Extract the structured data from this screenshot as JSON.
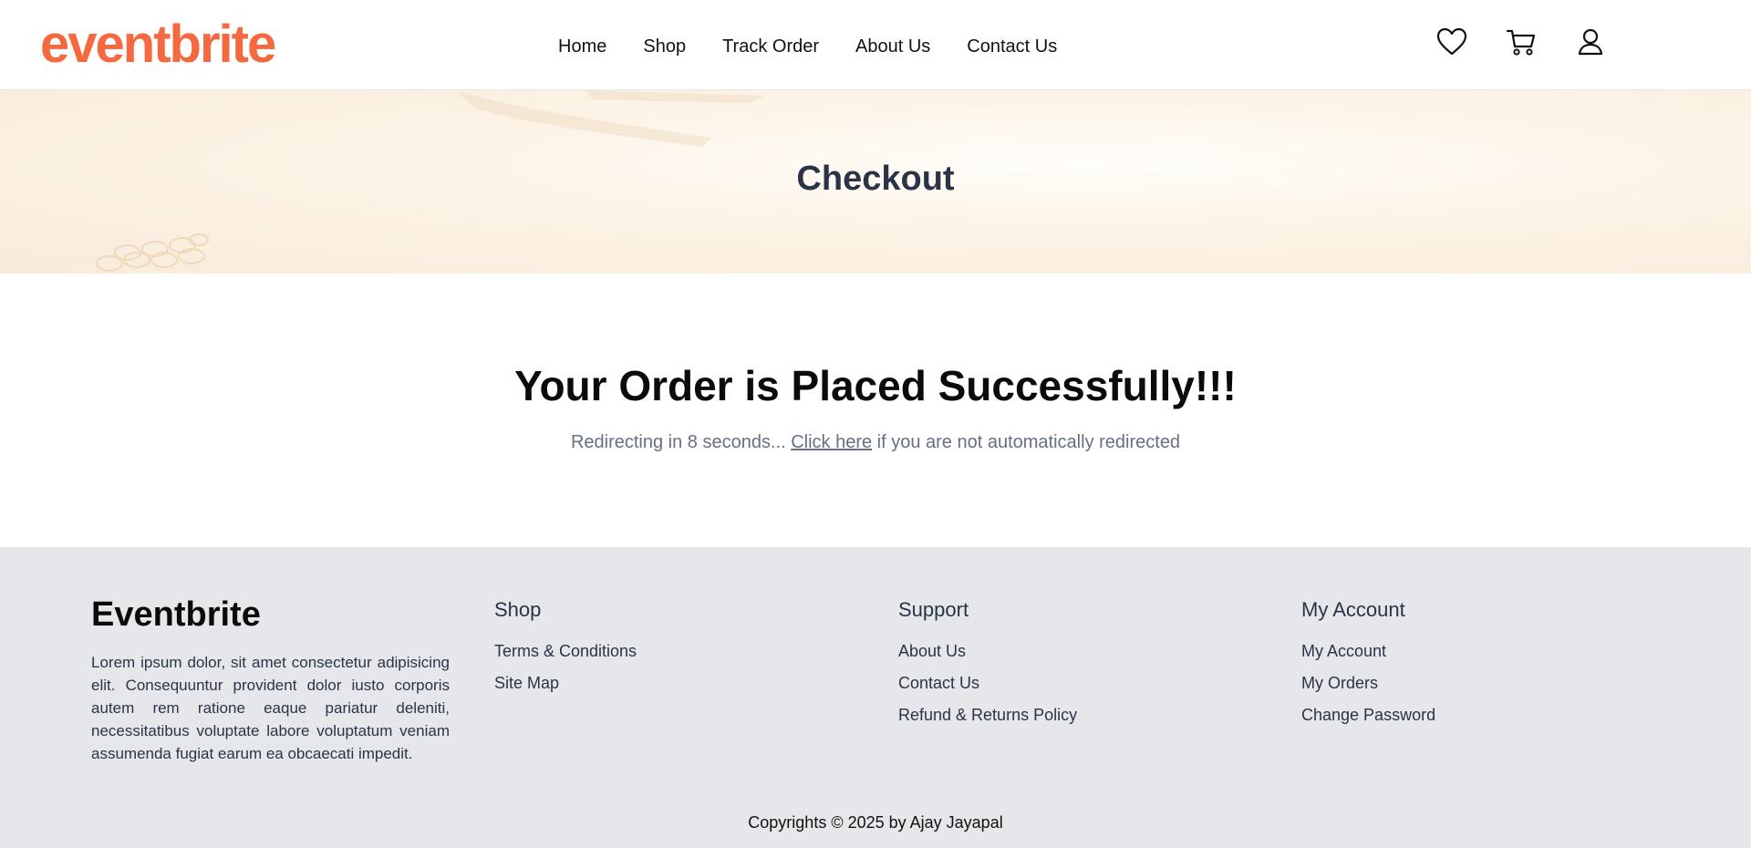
{
  "header": {
    "logo": "eventbrite",
    "nav": [
      "Home",
      "Shop",
      "Track Order",
      "About Us",
      "Contact Us"
    ],
    "icons": [
      "heart-icon",
      "cart-icon",
      "user-icon"
    ]
  },
  "banner": {
    "title": "Checkout"
  },
  "main": {
    "heading": "Your Order is Placed Successfully!!!",
    "redirect_prefix": "Redirecting in 8 seconds... ",
    "redirect_link": "Click here",
    "redirect_suffix": " if you are not automatically redirected"
  },
  "footer": {
    "brand": "Eventbrite",
    "description": "Lorem ipsum dolor, sit amet consectetur adipisicing elit. Consequuntur provident dolor iusto corporis autem rem ratione eaque pariatur deleniti, necessitatibus voluptate labore voluptatum veniam assumenda fugiat earum ea obcaecati impedit.",
    "columns": [
      {
        "title": "Shop",
        "links": [
          "Terms & Conditions",
          "Site Map"
        ]
      },
      {
        "title": "Support",
        "links": [
          "About Us",
          "Contact Us",
          "Refund & Returns Policy"
        ]
      },
      {
        "title": "My Account",
        "links": [
          "My Account",
          "My Orders",
          "Change Password"
        ]
      }
    ],
    "copyright": "Copyrights © 2025 by Ajay Jayapal"
  },
  "colors": {
    "brand": "#f4693f",
    "footer_bg": "#e5e7eb",
    "banner_bg": "#fcf3e6",
    "heading": "#2b3446"
  }
}
